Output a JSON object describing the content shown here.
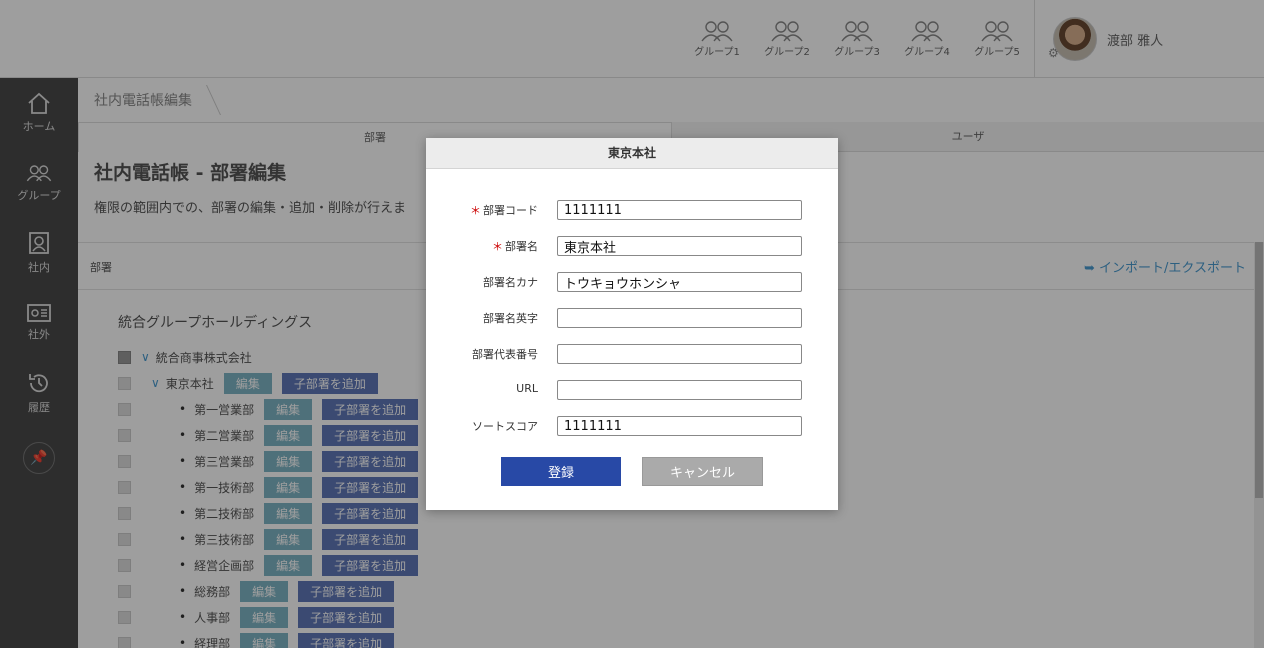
{
  "header": {
    "groups": [
      "グループ1",
      "グループ2",
      "グループ3",
      "グループ4",
      "グループ5"
    ],
    "username": "渡部 雅人"
  },
  "sidebar": {
    "items": [
      {
        "label": "ホーム",
        "icon": "home-icon"
      },
      {
        "label": "グループ",
        "icon": "group-icon"
      },
      {
        "label": "社内",
        "icon": "internal-contact-icon"
      },
      {
        "label": "社外",
        "icon": "external-contact-icon"
      },
      {
        "label": "履歴",
        "icon": "history-icon"
      }
    ],
    "pin_icon": "pin-icon"
  },
  "breadcrumb": {
    "item": "社内電話帳編集"
  },
  "tabs": [
    {
      "label": "部署",
      "active": true
    },
    {
      "label": "ユーザ",
      "active": false
    }
  ],
  "page": {
    "title": "社内電話帳 - 部署編集",
    "description": "権限の範囲内での、部署の編集・追加・削除が行えま"
  },
  "section": {
    "label": "部署",
    "import_link": "インポート/エクスポート"
  },
  "tree": {
    "root": "統合グループホールディングス",
    "company": "統合商事株式会社",
    "branch": "東京本社",
    "edit_label": "編集",
    "add_label": "子部署を追加",
    "departments": [
      "第一営業部",
      "第二営業部",
      "第三営業部",
      "第一技術部",
      "第二技術部",
      "第三技術部",
      "経営企画部",
      "総務部",
      "人事部",
      "経理部"
    ]
  },
  "modal": {
    "title": "東京本社",
    "fields": [
      {
        "label": "部署コード",
        "required": true,
        "value": "1111111"
      },
      {
        "label": "部署名",
        "required": true,
        "value": "東京本社"
      },
      {
        "label": "部署名カナ",
        "required": false,
        "value": "トウキョウホンシャ"
      },
      {
        "label": "部署名英字",
        "required": false,
        "value": ""
      },
      {
        "label": "部署代表番号",
        "required": false,
        "value": ""
      },
      {
        "label": "URL",
        "required": false,
        "value": ""
      },
      {
        "label": "ソートスコア",
        "required": false,
        "value": "1111111"
      }
    ],
    "required_mark": "＊",
    "submit_label": "登録",
    "cancel_label": "キャンセル"
  },
  "colors": {
    "primary": "#2849a6",
    "edit_button": "#7fb5c5",
    "add_button": "#6078b8",
    "sidebar": "#4a4a4a",
    "link": "#4a9bd0"
  }
}
